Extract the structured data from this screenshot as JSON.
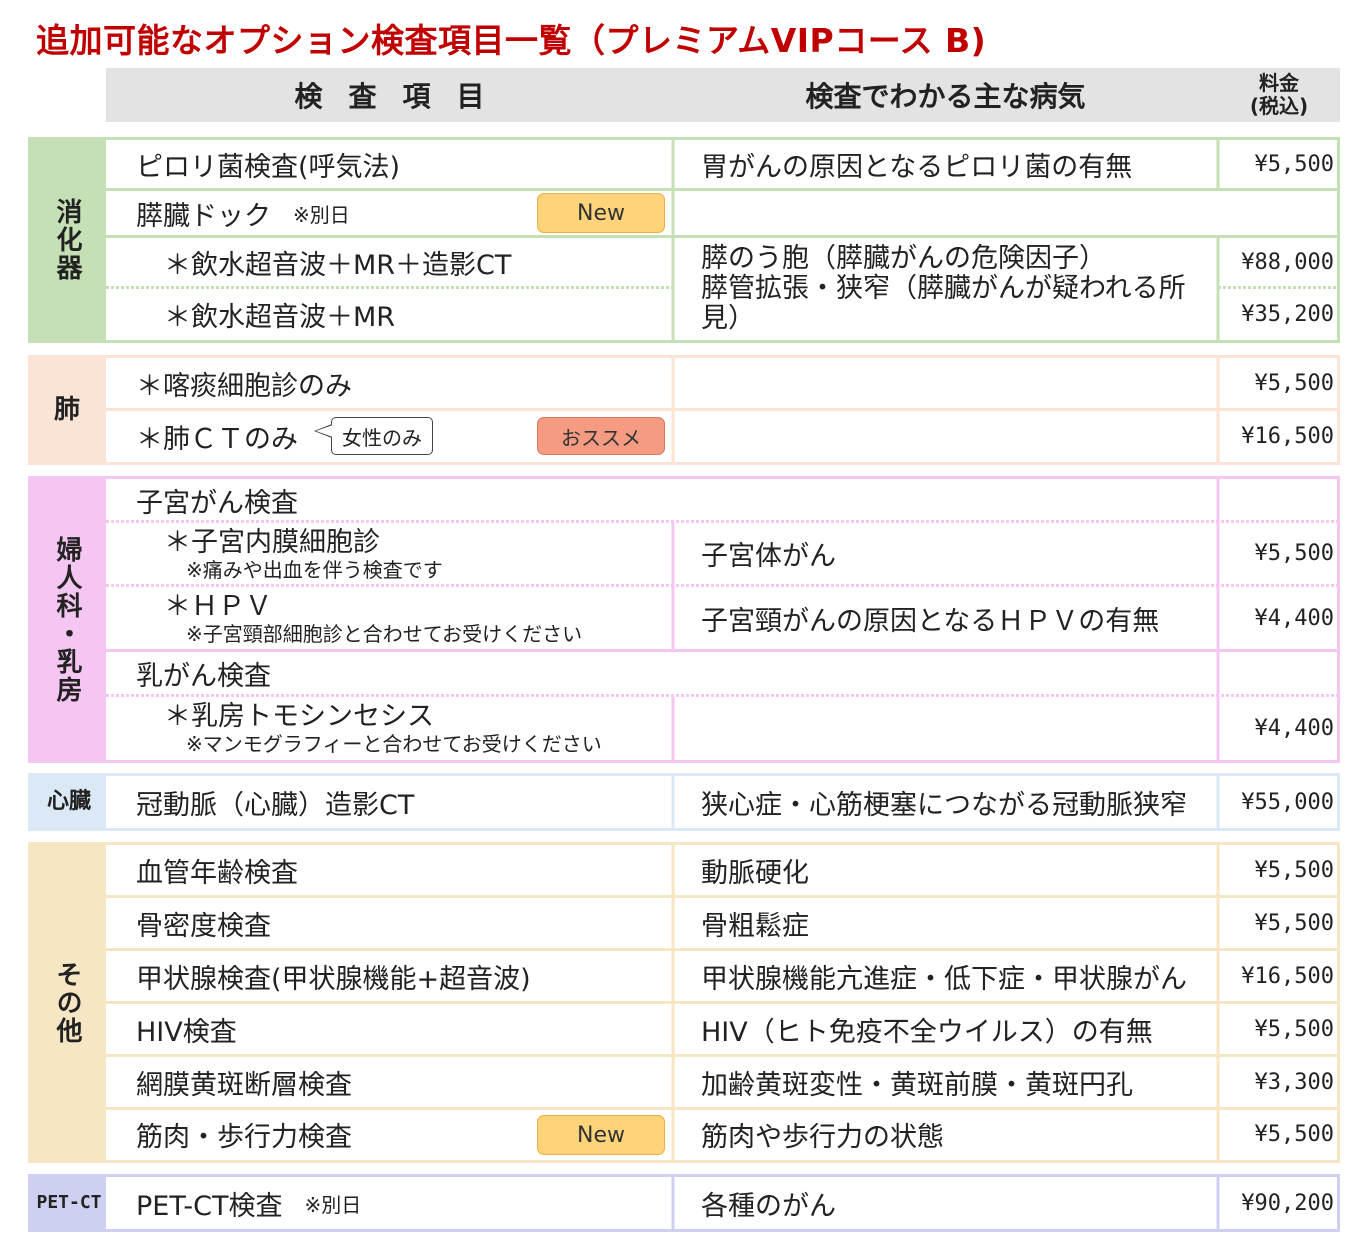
{
  "title": "追加可能なオプション検査項目一覧（プレミアムVIPコース B)",
  "header": {
    "item": "検査項目",
    "disease": "検査でわかる主な病気",
    "fee_line1": "料金",
    "fee_line2": "(税込)"
  },
  "colors": {
    "digestive": "#c5e0b4",
    "lung": "#fbe3d6",
    "gyne": "#f6c6f3",
    "heart": "#dbe8f5",
    "other": "#f7e6c3",
    "petct": "#cdd0f0",
    "title": "#c00000"
  },
  "sections": {
    "digestive": {
      "label": "消化器",
      "rows": {
        "r1": {
          "item": "ピロリ菌検査(呼気法)",
          "disease": "胃がんの原因となるピロリ菌の有無",
          "fee": "¥5,500"
        },
        "r2": {
          "item": "膵臓ドック",
          "note": "※別日",
          "badge": "New"
        },
        "r3": {
          "item": "＊飲水超音波＋MR＋造影CT",
          "fee": "¥88,000"
        },
        "r4": {
          "item": "＊飲水超音波＋MR",
          "fee": "¥35,200"
        },
        "merged_disease_line1": "膵のう胞（膵臓がんの危険因子）",
        "merged_disease_line2": "膵管拡張・狭窄（膵臓がんが疑われる所",
        "merged_disease_line3": "見）"
      }
    },
    "lung": {
      "label": "肺",
      "rows": {
        "r1": {
          "item": "＊喀痰細胞診のみ",
          "fee": "¥5,500"
        },
        "r2": {
          "item": "＊肺ＣＴのみ",
          "callout": "女性のみ",
          "badge": "おススメ",
          "fee": "¥16,500"
        }
      }
    },
    "gyne": {
      "label": "婦人科・乳房",
      "rows": {
        "r1": {
          "item": "子宮がん検査"
        },
        "r2": {
          "item": "＊子宮内膜細胞診",
          "note": "※痛みや出血を伴う検査です",
          "disease": "子宮体がん",
          "fee": "¥5,500"
        },
        "r3": {
          "item": "＊ＨＰＶ",
          "note": "※子宮頸部細胞診と合わせてお受けください",
          "disease": "子宮頸がんの原因となるＨＰＶの有無",
          "fee": "¥4,400"
        },
        "r4": {
          "item": "乳がん検査"
        },
        "r5": {
          "item": "＊乳房トモシンセシス",
          "note": "※マンモグラフィーと合わせてお受けください",
          "fee": "¥4,400"
        }
      }
    },
    "heart": {
      "label": "心臓",
      "rows": {
        "r1": {
          "item": "冠動脈（心臓）造影CT",
          "disease": "狭心症・心筋梗塞につながる冠動脈狭窄",
          "fee": "¥55,000"
        }
      }
    },
    "other": {
      "label": "その他",
      "rows": {
        "r1": {
          "item": "血管年齢検査",
          "disease": "動脈硬化",
          "fee": "¥5,500"
        },
        "r2": {
          "item": "骨密度検査",
          "disease": "骨粗鬆症",
          "fee": "¥5,500"
        },
        "r3": {
          "item": "甲状腺検査(甲状腺機能+超音波)",
          "disease": "甲状腺機能亢進症・低下症・甲状腺がん",
          "fee": "¥16,500"
        },
        "r4": {
          "item": "HIV検査",
          "disease": "HIV（ヒト免疫不全ウイルス）の有無",
          "fee": "¥5,500"
        },
        "r5": {
          "item": "網膜黄斑断層検査",
          "disease": "加齢黄斑変性・黄斑前膜・黄斑円孔",
          "fee": "¥3,300"
        },
        "r6": {
          "item": "筋肉・歩行力検査",
          "badge": "New",
          "disease": "筋肉や歩行力の状態",
          "fee": "¥5,500"
        }
      }
    },
    "petct": {
      "label": "PET-CT",
      "rows": {
        "r1": {
          "item": "PET-CT検査",
          "note": "※別日",
          "disease": "各種のがん",
          "fee": "¥90,200"
        }
      }
    }
  }
}
